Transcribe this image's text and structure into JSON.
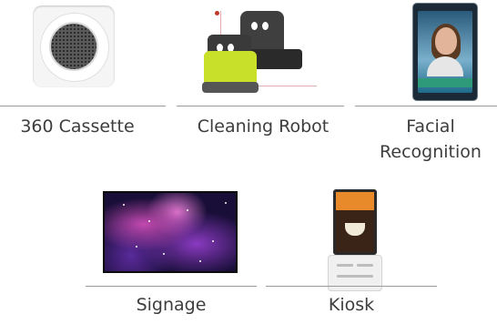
{
  "products": [
    {
      "label": "360 Cassette",
      "icon": "cassette-ac-icon"
    },
    {
      "label": "Cleaning Robot",
      "icon": "cleaning-robot-icon"
    },
    {
      "label": "Facial",
      "label_line2": "Recognition",
      "icon": "facial-recognition-icon"
    },
    {
      "label": "Signage",
      "icon": "signage-icon"
    },
    {
      "label": "Kiosk",
      "icon": "kiosk-icon"
    }
  ],
  "colors": {
    "label_text": "#3d3d3d",
    "divider": "#9a9a9a",
    "robot_accent": "#c8e02a"
  }
}
